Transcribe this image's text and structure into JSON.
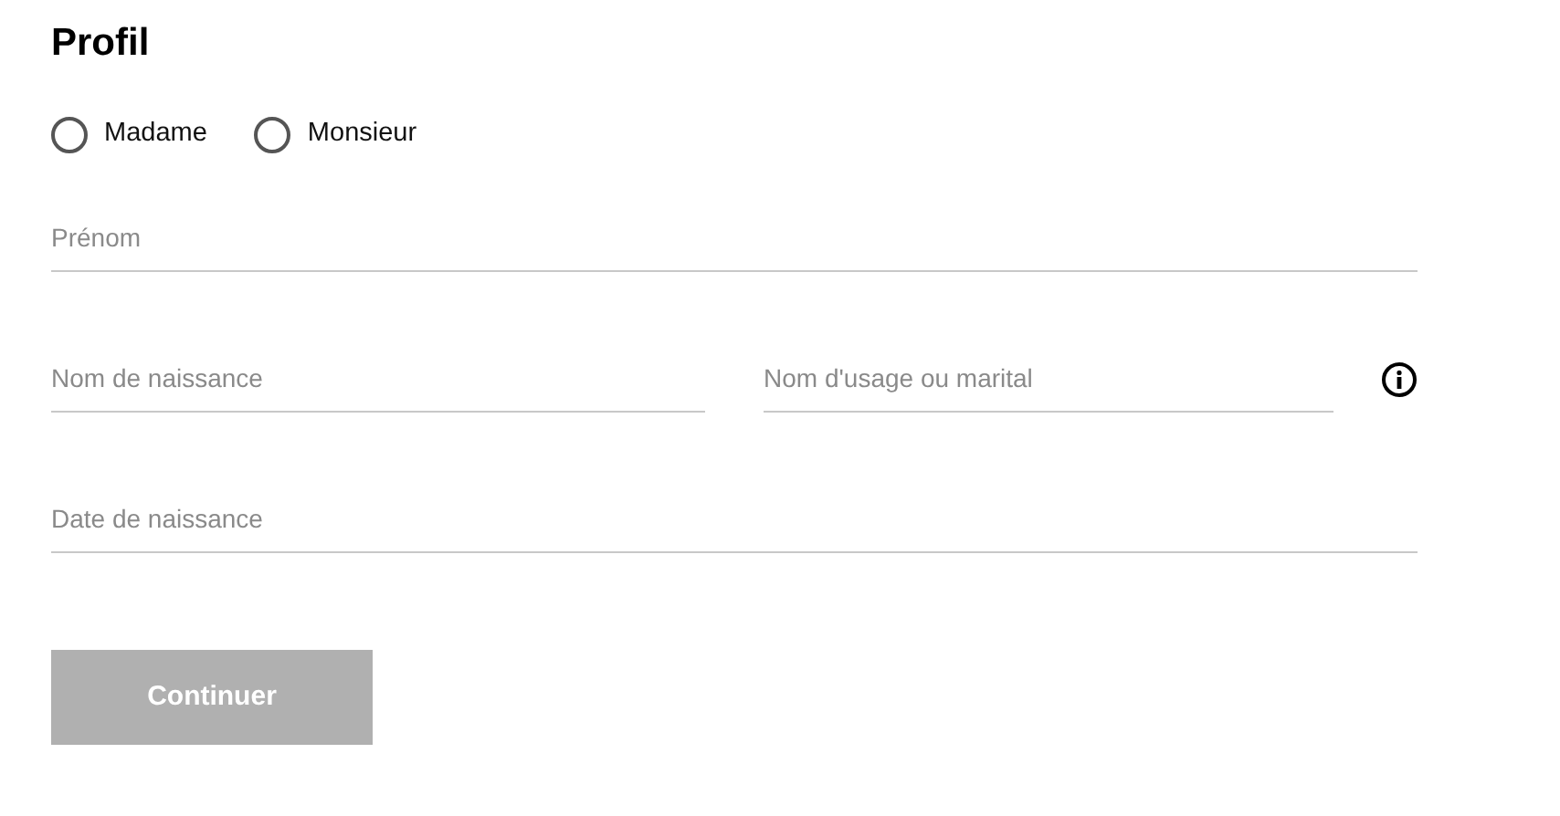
{
  "title": "Profil",
  "civility": [
    {
      "label": "Madame",
      "selected": false
    },
    {
      "label": "Monsieur",
      "selected": false
    }
  ],
  "field_rows": [
    [
      {
        "placeholder": "Prénom"
      }
    ],
    [
      {
        "placeholder": "Nom de naissance"
      },
      {
        "placeholder": "Nom d'usage ou marital",
        "info": true
      }
    ],
    [
      {
        "placeholder": "Date de naissance"
      }
    ]
  ],
  "submit": {
    "label": "Continuer",
    "disabled": true
  }
}
